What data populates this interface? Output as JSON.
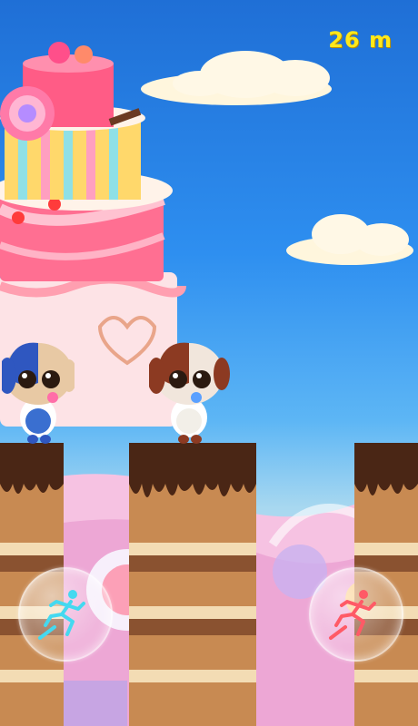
{
  "hud": {
    "distance_label": "26 m"
  },
  "colors": {
    "hud_text": "#ffe81a",
    "sky_top": "#1f6fd6",
    "chocolate": "#4a2615",
    "sponge": "#c88a52",
    "cream": "#f3dcb4",
    "left_button_icon": "#44d9f0",
    "right_button_icon": "#ff5a66"
  },
  "controls": {
    "left_button_icon": "jump-running-icon",
    "right_button_icon": "jump-running-icon"
  },
  "characters": [
    {
      "name": "blue-puppy",
      "color": "blue"
    },
    {
      "name": "brown-puppy",
      "color": "brown"
    }
  ]
}
